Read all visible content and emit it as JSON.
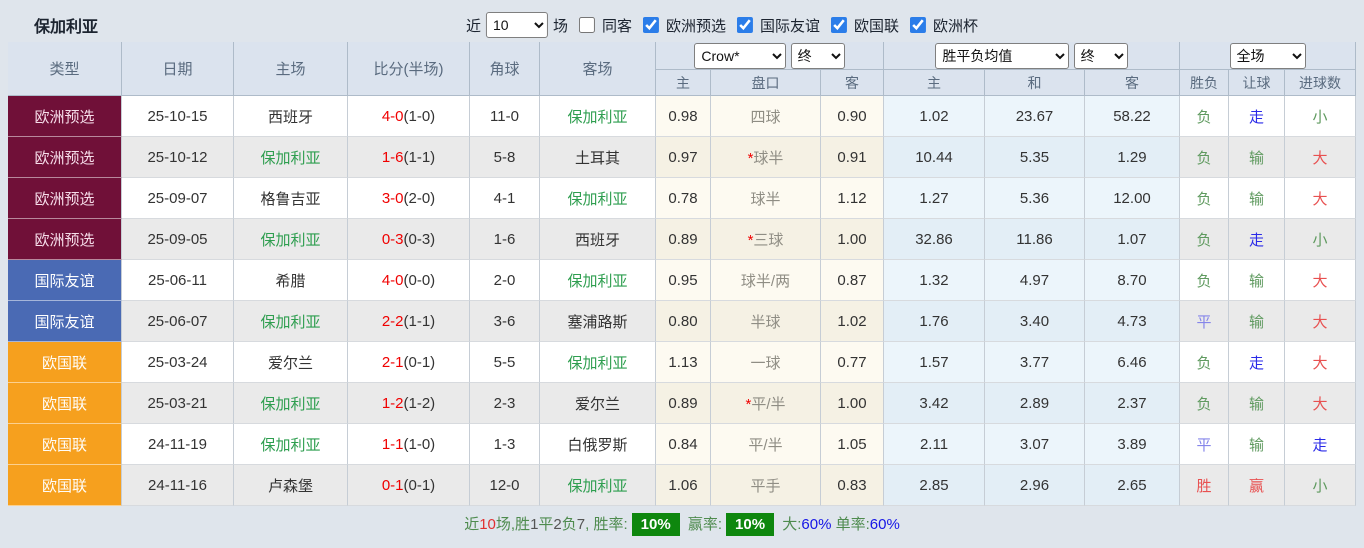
{
  "page": {
    "background": "#dfe5ec"
  },
  "header": {
    "team_title": "保加利亚",
    "recent_prefix": "近",
    "recent_count": "10",
    "recent_suffix": "场",
    "same_opponent_label": "同客",
    "filters": [
      {
        "label": "欧洲预选",
        "checked": true
      },
      {
        "label": "国际友谊",
        "checked": true
      },
      {
        "label": "欧国联",
        "checked": true
      },
      {
        "label": "欧洲杯",
        "checked": true
      }
    ]
  },
  "table": {
    "columns": [
      "类型",
      "日期",
      "主场",
      "比分(半场)",
      "角球",
      "客场"
    ],
    "odds_panel": {
      "company": "Crow*",
      "stage": "终"
    },
    "avg_panel": {
      "label": "胜平负均值",
      "stage": "终"
    },
    "scope_panel": {
      "label": "全场"
    },
    "odds_subheaders": [
      "主",
      "盘口",
      "客"
    ],
    "avg_subheaders": [
      "主",
      "和",
      "客"
    ],
    "result_subheaders": [
      "胜负",
      "让球",
      "进球数"
    ],
    "type_colors": {
      "欧洲预选": "#701038",
      "国际友谊": "#4a6ab4",
      "欧国联": "#f6a01e"
    },
    "rows": [
      {
        "type": "欧洲预选",
        "type_class": "t-maroon",
        "date": "25-10-15",
        "home": "西班牙",
        "home_hl": false,
        "score": "4-0",
        "half": "(1-0)",
        "corners": "11-0",
        "away": "保加利亚",
        "away_hl": true,
        "o_home": "0.98",
        "hstar": "",
        "handicap": "四球",
        "o_away": "0.90",
        "a_home": "1.02",
        "a_draw": "23.67",
        "a_away": "58.22",
        "res": "负",
        "res_c": "green",
        "hres": "走",
        "hres_c": "blue",
        "gres": "小",
        "gres_c": "green"
      },
      {
        "type": "欧洲预选",
        "type_class": "t-maroon",
        "date": "25-10-12",
        "home": "保加利亚",
        "home_hl": true,
        "score": "1-6",
        "half": "(1-1)",
        "corners": "5-8",
        "away": "土耳其",
        "away_hl": false,
        "o_home": "0.97",
        "hstar": "*",
        "handicap": "球半",
        "o_away": "0.91",
        "a_home": "10.44",
        "a_draw": "5.35",
        "a_away": "1.29",
        "res": "负",
        "res_c": "green",
        "hres": "输",
        "hres_c": "green",
        "gres": "大",
        "gres_c": "red"
      },
      {
        "type": "欧洲预选",
        "type_class": "t-maroon",
        "date": "25-09-07",
        "home": "格鲁吉亚",
        "home_hl": false,
        "score": "3-0",
        "half": "(2-0)",
        "corners": "4-1",
        "away": "保加利亚",
        "away_hl": true,
        "o_home": "0.78",
        "hstar": "",
        "handicap": "球半",
        "o_away": "1.12",
        "a_home": "1.27",
        "a_draw": "5.36",
        "a_away": "12.00",
        "res": "负",
        "res_c": "green",
        "hres": "输",
        "hres_c": "green",
        "gres": "大",
        "gres_c": "red"
      },
      {
        "type": "欧洲预选",
        "type_class": "t-maroon",
        "date": "25-09-05",
        "home": "保加利亚",
        "home_hl": true,
        "score": "0-3",
        "half": "(0-3)",
        "corners": "1-6",
        "away": "西班牙",
        "away_hl": false,
        "o_home": "0.89",
        "hstar": "*",
        "handicap": "三球",
        "o_away": "1.00",
        "a_home": "32.86",
        "a_draw": "11.86",
        "a_away": "1.07",
        "res": "负",
        "res_c": "green",
        "hres": "走",
        "hres_c": "blue",
        "gres": "小",
        "gres_c": "green"
      },
      {
        "type": "国际友谊",
        "type_class": "t-blue",
        "date": "25-06-11",
        "home": "希腊",
        "home_hl": false,
        "score": "4-0",
        "half": "(0-0)",
        "corners": "2-0",
        "away": "保加利亚",
        "away_hl": true,
        "o_home": "0.95",
        "hstar": "",
        "handicap": "球半/两",
        "o_away": "0.87",
        "a_home": "1.32",
        "a_draw": "4.97",
        "a_away": "8.70",
        "res": "负",
        "res_c": "green",
        "hres": "输",
        "hres_c": "green",
        "gres": "大",
        "gres_c": "red"
      },
      {
        "type": "国际友谊",
        "type_class": "t-blue",
        "date": "25-06-07",
        "home": "保加利亚",
        "home_hl": true,
        "score": "2-2",
        "half": "(1-1)",
        "corners": "3-6",
        "away": "塞浦路斯",
        "away_hl": false,
        "o_home": "0.80",
        "hstar": "",
        "handicap": "半球",
        "o_away": "1.02",
        "a_home": "1.76",
        "a_draw": "3.40",
        "a_away": "4.73",
        "res": "平",
        "res_c": "violet",
        "hres": "输",
        "hres_c": "green",
        "gres": "大",
        "gres_c": "red"
      },
      {
        "type": "欧国联",
        "type_class": "t-orange",
        "date": "25-03-24",
        "home": "爱尔兰",
        "home_hl": false,
        "score": "2-1",
        "half": "(0-1)",
        "corners": "5-5",
        "away": "保加利亚",
        "away_hl": true,
        "o_home": "1.13",
        "hstar": "",
        "handicap": "一球",
        "o_away": "0.77",
        "a_home": "1.57",
        "a_draw": "3.77",
        "a_away": "6.46",
        "res": "负",
        "res_c": "green",
        "hres": "走",
        "hres_c": "blue",
        "gres": "大",
        "gres_c": "red"
      },
      {
        "type": "欧国联",
        "type_class": "t-orange",
        "date": "25-03-21",
        "home": "保加利亚",
        "home_hl": true,
        "score": "1-2",
        "half": "(1-2)",
        "corners": "2-3",
        "away": "爱尔兰",
        "away_hl": false,
        "o_home": "0.89",
        "hstar": "*",
        "handicap": "平/半",
        "o_away": "1.00",
        "a_home": "3.42",
        "a_draw": "2.89",
        "a_away": "2.37",
        "res": "负",
        "res_c": "green",
        "hres": "输",
        "hres_c": "green",
        "gres": "大",
        "gres_c": "red"
      },
      {
        "type": "欧国联",
        "type_class": "t-orange",
        "date": "24-11-19",
        "home": "保加利亚",
        "home_hl": true,
        "score": "1-1",
        "half": "(1-0)",
        "corners": "1-3",
        "away": "白俄罗斯",
        "away_hl": false,
        "o_home": "0.84",
        "hstar": "",
        "handicap": "平/半",
        "o_away": "1.05",
        "a_home": "2.11",
        "a_draw": "3.07",
        "a_away": "3.89",
        "res": "平",
        "res_c": "violet",
        "hres": "输",
        "hres_c": "green",
        "gres": "走",
        "gres_c": "blue"
      },
      {
        "type": "欧国联",
        "type_class": "t-orange",
        "date": "24-11-16",
        "home": "卢森堡",
        "home_hl": false,
        "score": "0-1",
        "half": "(0-1)",
        "corners": "12-0",
        "away": "保加利亚",
        "away_hl": true,
        "o_home": "1.06",
        "hstar": "",
        "handicap": "平手",
        "o_away": "0.83",
        "a_home": "2.85",
        "a_draw": "2.96",
        "a_away": "2.65",
        "res": "胜",
        "res_c": "red",
        "hres": "赢",
        "hres_c": "red",
        "gres": "小",
        "gres_c": "green"
      }
    ]
  },
  "summary": {
    "segments": [
      {
        "t": "近",
        "c": "green"
      },
      {
        "t": "10",
        "c": "red"
      },
      {
        "t": "场,胜",
        "c": "green"
      },
      {
        "t": "1",
        "c": "dark"
      },
      {
        "t": "平",
        "c": "green"
      },
      {
        "t": "2",
        "c": "dark"
      },
      {
        "t": "负",
        "c": "green"
      },
      {
        "t": "7",
        "c": "dark"
      },
      {
        "t": ", 胜率:",
        "c": "green"
      },
      {
        "t": "10%",
        "c": "badge"
      },
      {
        "t": " 赢率:",
        "c": "green"
      },
      {
        "t": "10%",
        "c": "badge"
      },
      {
        "t": " 大:",
        "c": "green"
      },
      {
        "t": "60%",
        "c": "blue"
      },
      {
        "t": " 单率:",
        "c": "green"
      },
      {
        "t": "60%",
        "c": "blue"
      }
    ]
  },
  "colors": {
    "win_red": "#e85050",
    "lose_green": "#5f9a5f",
    "go_blue": "#2a2ae8",
    "draw_violet": "#8585ea",
    "team_green": "#2e9e4f",
    "score_red": "#f00000",
    "badge_green": "#0e870e",
    "percent_blue": "#1515e6"
  }
}
